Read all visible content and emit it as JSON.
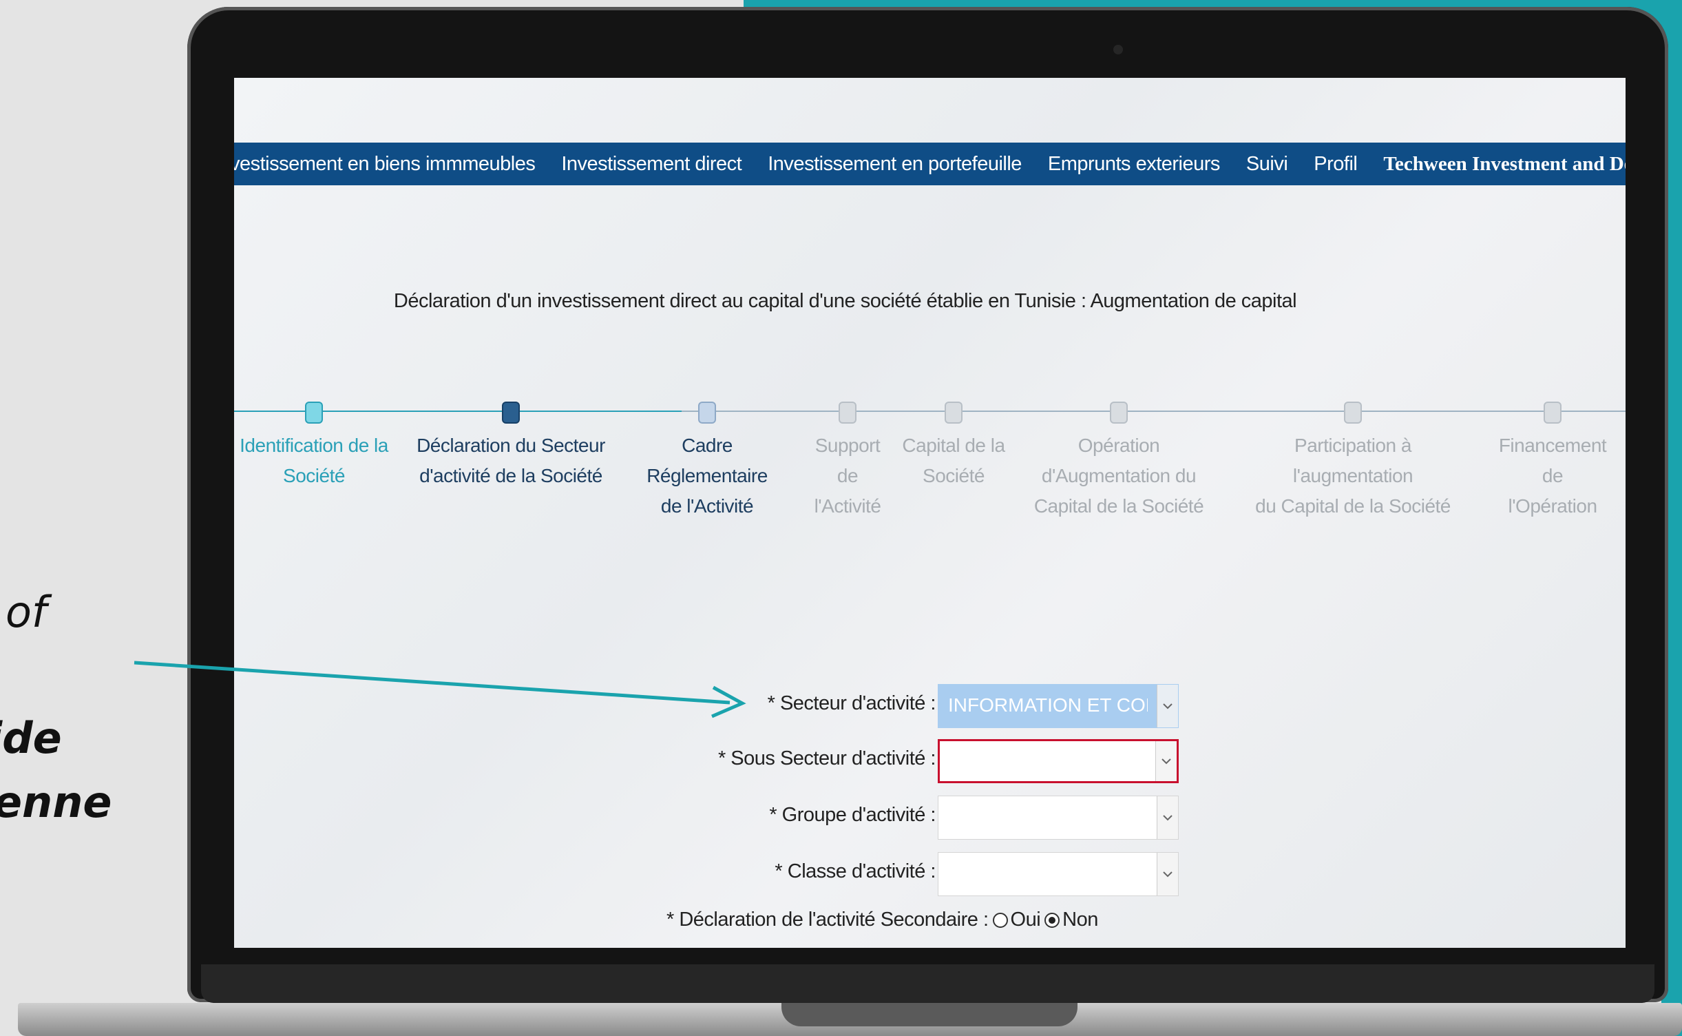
{
  "side_text": {
    "line1": "of",
    "line2": "ide",
    "line3": "enne"
  },
  "nav": {
    "items": [
      "vestissement en biens immmeubles",
      "Investissement direct",
      "Investissement en portefeuille",
      "Emprunts exterieurs",
      "Suivi",
      "Profil"
    ],
    "company": "Techween Investment and Development SPC",
    "icons": [
      "info-icon",
      "home-icon",
      "power-icon"
    ]
  },
  "page": {
    "title": "Déclaration d'un investissement direct au capital d'une société établie en Tunisie : Augmentation de capital"
  },
  "stepper": {
    "steps": [
      {
        "line1": "Identification de la",
        "line2": "Société",
        "state": "done"
      },
      {
        "line1": "Déclaration du Secteur",
        "line2": "d'activité de la Société",
        "state": "current"
      },
      {
        "line1": "Cadre Réglementaire",
        "line2": "de l'Activité",
        "state": "next"
      },
      {
        "line1": "Support de",
        "line2": "l'Activité",
        "state": "pending"
      },
      {
        "line1": "Capital de la",
        "line2": "Société",
        "state": "pending"
      },
      {
        "line1": "Opération d'Augmentation du",
        "line2": "Capital de la Société",
        "state": "pending"
      },
      {
        "line1": "Participation à l'augmentation",
        "line2": "du Capital de la Société",
        "state": "pending"
      },
      {
        "line1": "Financement de",
        "line2": "l'Opération",
        "state": "pending"
      }
    ]
  },
  "form": {
    "secteur_label": "* Secteur d'activité :",
    "secteur_value": "INFORMATION ET COMMUNICATION",
    "sous_secteur_label": "* Sous Secteur d'activité :",
    "sous_secteur_value": "",
    "groupe_label": "* Groupe d'activité :",
    "groupe_value": "",
    "classe_label": "* Classe d'activité :",
    "classe_value": "",
    "secondaire_label": "* Déclaration de l'activité Secondaire :",
    "option_oui": "Oui",
    "option_non": "Non",
    "selected": "Non"
  },
  "colors": {
    "navbar": "#0f4d86",
    "accent_teal": "#1aa3ad",
    "error_border": "#c8102e",
    "selected_field": "#a9cdf0"
  }
}
